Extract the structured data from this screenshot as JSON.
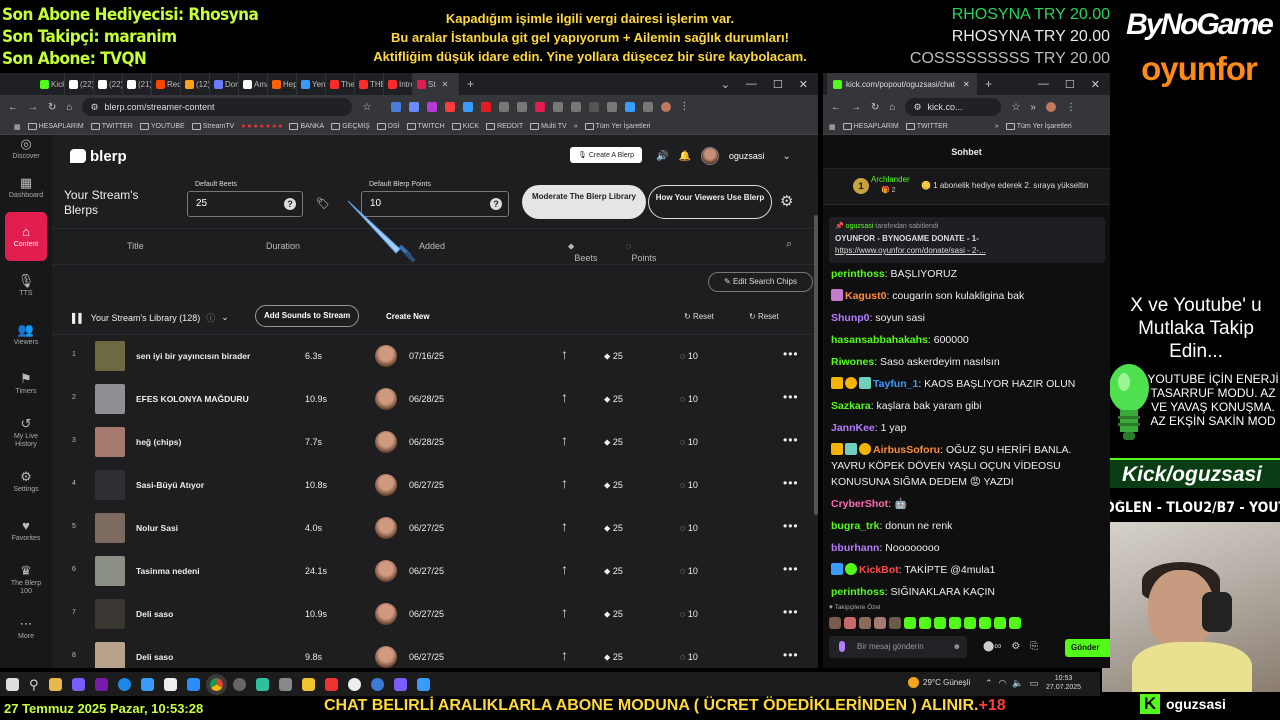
{
  "overlay": {
    "left_lines": [
      "Son Abone Hediyecisi: Rhosyna",
      "Son Takipçi: maranim",
      "Son Abone: TVQN"
    ],
    "center_lines": [
      "Kapadığım işimle ilgili vergi dairesi işlerim var.",
      "Bu aralar İstanbula git gel yapıyorum + Ailemin sağlık durumları!",
      "Aktifliğim düşük idare edin. Yine yollara düşecez bir süre kaybolacam."
    ],
    "donors": [
      "RHOSYNA TRY 20.00",
      "RHOSYNA TRY 20.00",
      "COSSSSSSSSS TRY 20.00"
    ],
    "brand_top": "ByNoGame",
    "brand_bottom": "oyunfor",
    "follow_text": "X ve Youtube' u Mutlaka Takip Edin...",
    "energy_text": "YOUTUBE İÇİN ENERJİ TASARRUF MODU. AZ VE YAVAŞ KONUŞMA. AZ EKŞİN SAKİN MOD",
    "kick_handle": "Kick/oguzsasi",
    "schedule": "ÖĞLEN - TLOU2/B7 - YOUTUBE",
    "bottom_date": "27 Temmuz 2025 Pazar, 10:53:28",
    "bottom_ticker": "CHAT BELIRLİ ARALIKLARLA ABONE MODUNA ( ÜCRET ÖDEDİKLERİNDEN ) ALINIR.",
    "bottom_ticker_tag": "+18",
    "bottom_kick_name": "oguzsasi",
    "bottom_kick_logo": "K"
  },
  "browser": {
    "tabs": [
      {
        "label": "Kickle",
        "color": "#53fc18"
      },
      {
        "label": "(22) A",
        "color": "#ffffff"
      },
      {
        "label": "(22) X",
        "color": "#ffffff"
      },
      {
        "label": "(21) A",
        "color": "#ffffff"
      },
      {
        "label": "Reddi",
        "color": "#ff4500"
      },
      {
        "label": "(12) D",
        "color": "#ff9f1a"
      },
      {
        "label": "Donat",
        "color": "#6a7bff"
      },
      {
        "label": "Amaz",
        "color": "#ffffff"
      },
      {
        "label": "Hepsi",
        "color": "#ff6000"
      },
      {
        "label": "Yeni S",
        "color": "#3a9bff"
      },
      {
        "label": "The S",
        "color": "#ff2a2a"
      },
      {
        "label": "THE S",
        "color": "#ff2a2a"
      },
      {
        "label": "Introd",
        "color": "#ff2a2a"
      },
      {
        "label": "St",
        "color": "#e21d4f"
      }
    ],
    "url": "blerp.com/streamer-content",
    "bookmarks": [
      "HESAPLARIM",
      "TWITTER",
      "YOUTUBE",
      "StreamTV",
      "BANKA",
      "GEÇMİŞ",
      "DSİ",
      "TWITCH",
      "KICK",
      "REDDIT",
      "Multi TV",
      "Tüm Yer İşaretleri"
    ]
  },
  "blerp": {
    "logo": "blerp",
    "sidebar": [
      {
        "label": "Discover",
        "icon": "compass-icon",
        "glyph": "◎"
      },
      {
        "label": "Dashboard",
        "icon": "grid-icon",
        "glyph": "▦"
      },
      {
        "label": "Content",
        "icon": "home-icon",
        "glyph": "⌂"
      },
      {
        "label": "TTS",
        "icon": "mic-icon",
        "glyph": "🎙"
      },
      {
        "label": "Viewers",
        "icon": "users-icon",
        "glyph": "👥"
      },
      {
        "label": "Timers",
        "icon": "flag-icon",
        "glyph": "⚑"
      },
      {
        "label": "My Live History",
        "icon": "history-icon",
        "glyph": "↺"
      },
      {
        "label": "Settings",
        "icon": "gear-icon",
        "glyph": "⚙"
      },
      {
        "label": "Favorites",
        "icon": "heart-icon",
        "glyph": "♥"
      },
      {
        "label": "The Blerp 100",
        "icon": "crown-icon",
        "glyph": "♛"
      },
      {
        "label": "More",
        "icon": "more-icon",
        "glyph": "⋯"
      }
    ],
    "create_blerp": "Create A Blerp",
    "username": "oguzsasi",
    "stream_title": "Your Stream's Blerps",
    "default_beets_label": "Default Beets",
    "default_beets_value": "25",
    "default_points_label": "Default Blerp Points",
    "default_points_value": "10",
    "moderate_btn": "Moderate The Blerp Library",
    "how_btn": "How Your Viewers Use Blerp",
    "columns": {
      "title": "Title",
      "duration": "Duration",
      "added": "Added",
      "beets": "Beets",
      "points": "Points"
    },
    "edit_chips": "Edit Search Chips",
    "library_title": "Your Stream's Library (128)",
    "add_sounds": "Add Sounds to Stream",
    "create_new": "Create New",
    "reset1": "Reset",
    "reset2": "Reset",
    "rows": [
      {
        "idx": "1",
        "title": "sen iyi bir yayıncısın birader",
        "duration": "6.3s",
        "date": "07/16/25",
        "beets": "25",
        "points": "10",
        "thumb": "#6b6a43"
      },
      {
        "idx": "2",
        "title": "EFES KOLONYA MAĞDURU",
        "duration": "10.9s",
        "date": "06/28/25",
        "beets": "25",
        "points": "10",
        "thumb": "#8e8f93"
      },
      {
        "idx": "3",
        "title": "heğ (chips)",
        "duration": "7.7s",
        "date": "06/28/25",
        "beets": "25",
        "points": "10",
        "thumb": "#a67a6e"
      },
      {
        "idx": "4",
        "title": "Sasi-Büyü Atıyor",
        "duration": "10.8s",
        "date": "06/27/25",
        "beets": "25",
        "points": "10",
        "thumb": "#2e2f33"
      },
      {
        "idx": "5",
        "title": "Nolur Sasi",
        "duration": "4.0s",
        "date": "06/27/25",
        "beets": "25",
        "points": "10",
        "thumb": "#7d6a5f"
      },
      {
        "idx": "6",
        "title": "Tasinma nedeni",
        "duration": "24.1s",
        "date": "06/27/25",
        "beets": "25",
        "points": "10",
        "thumb": "#8a8f86"
      },
      {
        "idx": "7",
        "title": "Deli saso",
        "duration": "10.9s",
        "date": "06/27/25",
        "beets": "25",
        "points": "10",
        "thumb": "#3a3632"
      },
      {
        "idx": "8",
        "title": "Deli saso",
        "duration": "9.8s",
        "date": "06/27/25",
        "beets": "25",
        "points": "10",
        "thumb": "#b8a38a"
      }
    ]
  },
  "chat": {
    "tab_label": "kick.com/popout/oguzsasi/chat",
    "url": "kick.co...",
    "bookmarks": [
      "HESAPLARIM",
      "TWITTER",
      "Tüm Yer İşaretleri"
    ],
    "header": "Sohbet",
    "gift_user": "Archlander",
    "gift_count": "2",
    "gift_msg": "1 abonelik hediye ederek 2. sıraya yükseltin",
    "gift_rank": "1",
    "pinned_by_user": "oguzsasi",
    "pinned_by_suffix": "tarafından sabitlendi",
    "pinned_title": "OYUNFOR - BYNOGAME DONATE - 1-",
    "pinned_link": "https://www.oyunfor.com/donate/sasi - 2-...",
    "messages": [
      {
        "user": "perinthoss",
        "text": "BAŞLIYORUZ",
        "color": "#53fc18"
      },
      {
        "user": "Kagust0",
        "text": "cougarin son kulakligina bak",
        "color": "#ff8a3a"
      },
      {
        "user": "Shunp0",
        "text": "soyun sasi",
        "color": "#b67cff"
      },
      {
        "user": "hasansabbahakahs",
        "text": "600000",
        "color": "#53fc18"
      },
      {
        "user": "Riwones",
        "text": "Saso askerdeyim nasılsın",
        "color": "#53fc18"
      },
      {
        "user": "Tayfun_1",
        "text": "KAOS BAŞLIYOR HAZIR OLUN",
        "color": "#3a9bff"
      },
      {
        "user": "Sazkara",
        "text": "kaşlara bak yaram gibi",
        "color": "#53fc18"
      },
      {
        "user": "JannKee",
        "text": "1 yap",
        "color": "#b67cff"
      },
      {
        "user": "AirbusSoforu",
        "text": "OĞUZ ŞU HERİFİ BANLA. YAVRU KÖPEK DÖVEN YAŞLI OÇUN VİDEOSU KONUSUNA SIĞMA DEDEM 😡 YAZDI",
        "color": "#ff8a3a"
      },
      {
        "user": "CryberShot",
        "text": "🤖",
        "color": "#ff6bb0"
      },
      {
        "user": "bugra_trk",
        "text": "donun ne renk",
        "color": "#53fc18"
      },
      {
        "user": "bburhann",
        "text": "Noooooooo",
        "color": "#b67cff"
      },
      {
        "user": "KickBot",
        "text": "TAKİPTE @4mula1",
        "color": "#ff4a4a"
      },
      {
        "user": "perinthoss",
        "text": "SIĞINAKLARA KAÇIN",
        "color": "#53fc18"
      }
    ],
    "follower_note": "Takipçilere Özel",
    "input_placeholder": "Bir mesaj gönderin",
    "send": "Gönder"
  },
  "taskbar": {
    "weather": "29°C Güneşli",
    "time": "10:53",
    "date": "27.07.2025"
  }
}
